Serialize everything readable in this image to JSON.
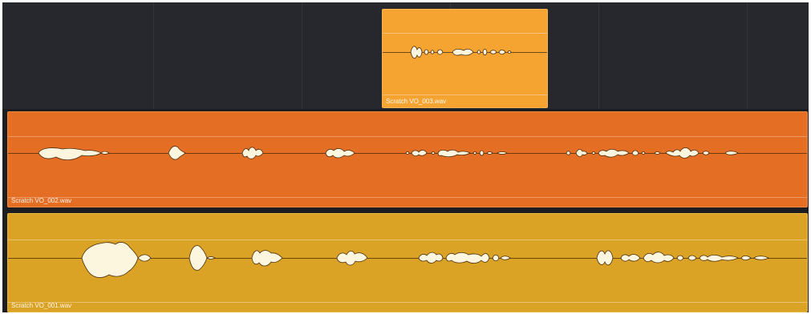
{
  "timeline": {
    "clips": [
      {
        "id": "clip3",
        "name": "Scratch VO_003.wav",
        "color": "#f6a431"
      },
      {
        "id": "clip2",
        "name": "Scratch VO_002.wav",
        "color": "#e46f24"
      },
      {
        "id": "clip1",
        "name": "Scratch VO_001.wav",
        "color": "#dba325"
      }
    ]
  }
}
